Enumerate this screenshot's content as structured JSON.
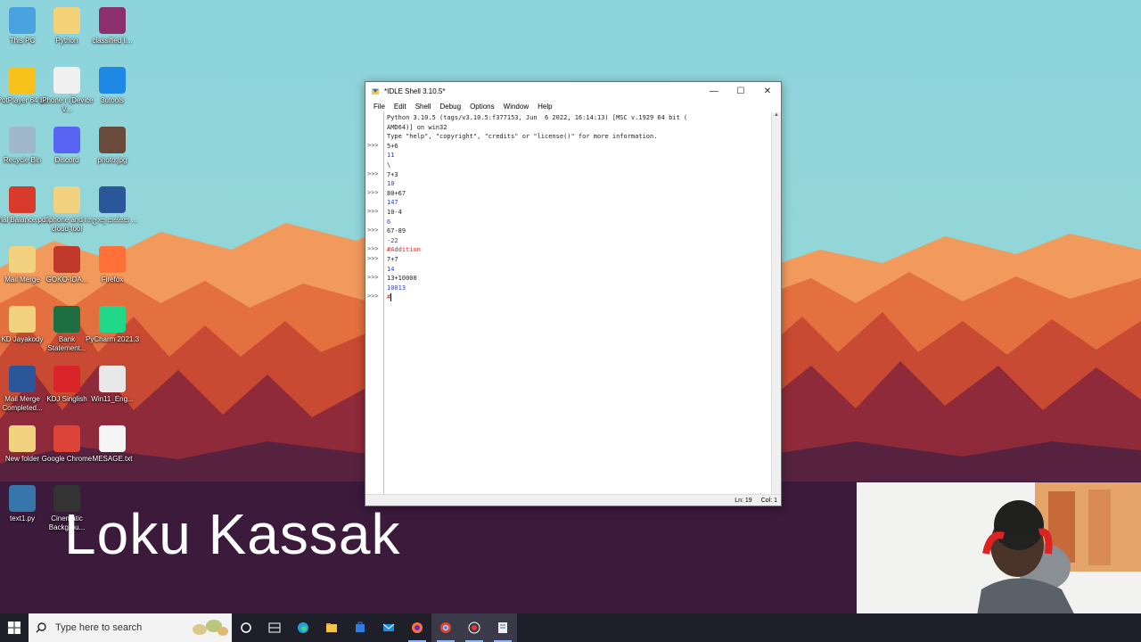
{
  "desktop_icons": [
    {
      "label": "This PC",
      "icon": "this-pc-icon",
      "color": "#4aa3df"
    },
    {
      "label": "Python",
      "icon": "python-folder-icon",
      "color": "#f4d27a"
    },
    {
      "label": "classified li...",
      "icon": "winrar-icon",
      "color": "#8c2f6e"
    },
    {
      "label": "PotPlayer 64 bit",
      "icon": "potplayer-icon",
      "color": "#f6c21b"
    },
    {
      "label": "iPhone r (Device V...",
      "icon": "iphone-tool-icon",
      "color": "#f0f0f0"
    },
    {
      "label": "3utools",
      "icon": "3utools-icon",
      "color": "#1e88e5"
    },
    {
      "label": "Recycle Bin",
      "icon": "recycle-bin-icon",
      "color": "#9fb8cc"
    },
    {
      "label": "Discord",
      "icon": "discord-icon",
      "color": "#5865f2"
    },
    {
      "label": "photo.jpg",
      "icon": "photo-icon",
      "color": "#6a4a3a"
    },
    {
      "label": "trial Balance.pdf",
      "icon": "pdf-icon",
      "color": "#d83b2b"
    },
    {
      "label": "iphone and i cloud tool",
      "icon": "folder-icon",
      "color": "#f3d27f"
    },
    {
      "label": "ලොකු කස්සක ...",
      "icon": "word-doc-icon",
      "color": "#2b579a"
    },
    {
      "label": "Mail Merge",
      "icon": "folder-icon",
      "color": "#f3d27f"
    },
    {
      "label": "GOKO-IDA...",
      "icon": "image-icon",
      "color": "#c0392b"
    },
    {
      "label": "Firefox",
      "icon": "firefox-icon",
      "color": "#ff7139"
    },
    {
      "label": "KD Jayakody",
      "icon": "folder-icon",
      "color": "#f3d27f"
    },
    {
      "label": "Bank Statement...",
      "icon": "excel-icon",
      "color": "#1d6f42"
    },
    {
      "label": "PyCharm 2021.3",
      "icon": "pycharm-icon",
      "color": "#21d789"
    },
    {
      "label": "Mail Merge Completed...",
      "icon": "word-doc-icon",
      "color": "#2b579a"
    },
    {
      "label": "KDJ Singlish",
      "icon": "singlish-icon",
      "color": "#d9252a"
    },
    {
      "label": "Win11_Eng...",
      "icon": "disc-image-icon",
      "color": "#e8e8e8"
    },
    {
      "label": "New folder",
      "icon": "folder-icon",
      "color": "#f3d27f"
    },
    {
      "label": "Google Chrome",
      "icon": "chrome-icon",
      "color": "#db4437"
    },
    {
      "label": "MESAGE.txt",
      "icon": "text-file-icon",
      "color": "#f5f5f5"
    },
    {
      "label": "text1.py",
      "icon": "python-file-icon",
      "color": "#3776ab"
    },
    {
      "label": "Cinematic Backgrou...",
      "icon": "video-icon",
      "color": "#333333"
    }
  ],
  "overlay": {
    "title": "Loku Kassak"
  },
  "idle": {
    "title": "*IDLE Shell 3.10.5*",
    "menu": [
      "File",
      "Edit",
      "Shell",
      "Debug",
      "Options",
      "Window",
      "Help"
    ],
    "prompt": ">>>",
    "lines": [
      {
        "text": "Python 3.10.5 (tags/v3.10.5:f377153, Jun  6 2022, 16:14:13) [MSC v.1929 64 bit (",
        "kind": "plain",
        "prompt": false
      },
      {
        "text": "AMD64)] on win32",
        "kind": "plain",
        "prompt": false
      },
      {
        "text": "Type \"help\", \"copyright\", \"credits\" or \"license()\" for more information.",
        "kind": "plain",
        "prompt": false
      },
      {
        "text": "5+6",
        "kind": "plain",
        "prompt": true
      },
      {
        "text": "11",
        "kind": "out",
        "prompt": false
      },
      {
        "text": "\\",
        "kind": "plain",
        "prompt": false
      },
      {
        "text": "7+3",
        "kind": "plain",
        "prompt": true
      },
      {
        "text": "10",
        "kind": "out",
        "prompt": false
      },
      {
        "text": "80+67",
        "kind": "plain",
        "prompt": true
      },
      {
        "text": "147",
        "kind": "out",
        "prompt": false
      },
      {
        "text": "10-4",
        "kind": "plain",
        "prompt": true
      },
      {
        "text": "6",
        "kind": "out",
        "prompt": false
      },
      {
        "text": "67-89",
        "kind": "plain",
        "prompt": true
      },
      {
        "text": "-22",
        "kind": "out",
        "prompt": false
      },
      {
        "text": "#Addition",
        "kind": "cmt",
        "prompt": true
      },
      {
        "text": "7+7",
        "kind": "plain",
        "prompt": true
      },
      {
        "text": "14",
        "kind": "out",
        "prompt": false
      },
      {
        "text": "13+10000",
        "kind": "plain",
        "prompt": true
      },
      {
        "text": "10013",
        "kind": "out",
        "prompt": false
      },
      {
        "text": "#",
        "kind": "cmt",
        "prompt": true
      }
    ],
    "status": {
      "line": "Ln: 19",
      "col": "Col: 1"
    }
  },
  "taskbar": {
    "search_placeholder": "Type here to search",
    "apps": [
      {
        "name": "cortana-icon"
      },
      {
        "name": "task-view-icon"
      },
      {
        "name": "edge-icon"
      },
      {
        "name": "file-explorer-icon"
      },
      {
        "name": "store-icon"
      },
      {
        "name": "mail-icon"
      },
      {
        "name": "firefox-icon"
      },
      {
        "name": "chrome-icon"
      },
      {
        "name": "screen-recorder-icon"
      },
      {
        "name": "idle-icon"
      }
    ]
  }
}
